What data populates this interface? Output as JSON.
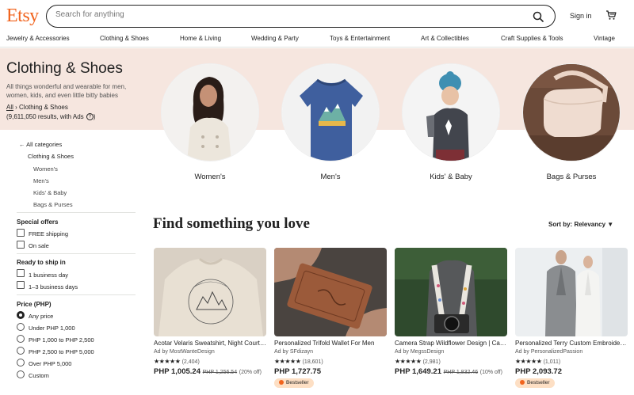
{
  "header": {
    "logo": "Etsy",
    "search_placeholder": "Search for anything",
    "signin": "Sign in"
  },
  "nav": [
    "Jewelry & Accessories",
    "Clothing & Shoes",
    "Home & Living",
    "Wedding & Party",
    "Toys & Entertainment",
    "Art & Collectibles",
    "Craft Supplies & Tools",
    "Vintage"
  ],
  "hero": {
    "title": "Clothing & Shoes",
    "description": "All things wonderful and wearable for men, women, kids, and even little bitty babies",
    "crumb_all": "All",
    "crumb_sep": "›",
    "crumb_current": "Clothing & Shoes",
    "results": "(9,611,050 results, with Ads",
    "results_close": ")"
  },
  "circles": [
    {
      "label": "Women's"
    },
    {
      "label": "Men's"
    },
    {
      "label": "Kids' & Baby"
    },
    {
      "label": "Bags & Purses"
    }
  ],
  "sidebar": {
    "all_categories": "← All categories",
    "current": "Clothing & Shoes",
    "subcats": [
      "Women's",
      "Men's",
      "Kids' & Baby",
      "Bags & Purses"
    ],
    "special_offers": {
      "heading": "Special offers",
      "options": [
        "FREE shipping",
        "On sale"
      ]
    },
    "ready_to_ship": {
      "heading": "Ready to ship in",
      "options": [
        "1 business day",
        "1–3 business days"
      ]
    },
    "price": {
      "heading": "Price (PHP)",
      "options": [
        "Any price",
        "Under PHP 1,000",
        "PHP 1,000 to PHP 2,500",
        "PHP 2,500 to PHP 5,000",
        "Over PHP 5,000",
        "Custom"
      ],
      "selected": "Any price"
    }
  },
  "main": {
    "heading": "Find something you love",
    "sort_label": "Sort by: Relevancy ▼"
  },
  "products": [
    {
      "title": "Acotar Velaris Sweatshirt, Night Court Sweatshirt",
      "shop": "Ad by MostWanteDesign",
      "stars": "★★★★★",
      "reviews": "(2,404)",
      "price": "PHP 1,005.24",
      "orig_price": "PHP 1,256.54",
      "discount": "(20% off)",
      "badge": ""
    },
    {
      "title": "Personalized Trifold Wallet For Men",
      "shop": "Ad by SFdizayn",
      "stars": "★★★★★",
      "reviews": "(18,601)",
      "price": "PHP 1,727.75",
      "orig_price": "",
      "discount": "",
      "badge": "Bestseller"
    },
    {
      "title": "Camera Strap Wildflower Design | Camera Strap",
      "shop": "Ad by MegssDesign",
      "stars": "★★★★★",
      "reviews": "(2,981)",
      "price": "PHP 1,649.21",
      "orig_price": "PHP 1,832.46",
      "discount": "(10% off)",
      "badge": ""
    },
    {
      "title": "Personalized Terry Custom Embroidered Robe",
      "shop": "Ad by PersonalizedPassion",
      "stars": "★★★★★",
      "reviews": "(1,011)",
      "price": "PHP 2,093.72",
      "orig_price": "",
      "discount": "",
      "badge": "Bestseller"
    }
  ],
  "colors": {
    "brand": "#f1641e",
    "hero_bg": "#f6e6df",
    "badge_bg": "#fddfc4"
  }
}
